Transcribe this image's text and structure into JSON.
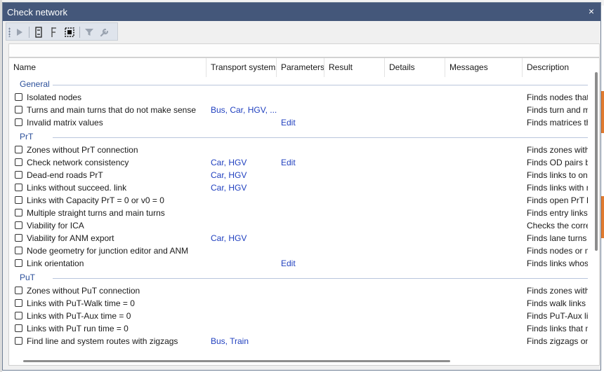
{
  "window": {
    "title": "Check network",
    "close_label": "×"
  },
  "toolbar": {
    "items": [
      {
        "name": "run-icon",
        "glyph": "▶"
      },
      {
        "name": "collapse-icon",
        "glyph": "⇟"
      },
      {
        "name": "expand-icon",
        "glyph": "⇞"
      },
      {
        "name": "select-icon",
        "glyph": "⬚"
      },
      {
        "name": "filter-icon",
        "glyph": "⏷"
      },
      {
        "name": "wrench-icon",
        "glyph": "✎"
      }
    ]
  },
  "columns": [
    "Name",
    "Transport systems",
    "Parameters",
    "Result",
    "Details",
    "Messages",
    "Description"
  ],
  "groups": [
    {
      "label": "General",
      "rows": [
        {
          "name": "Isolated nodes",
          "transport": "",
          "params": "",
          "desc": "Finds nodes that a"
        },
        {
          "name": "Turns and main turns that do not make sense",
          "transport": "Bus, Car, HGV, ...",
          "params": "",
          "desc": "Finds turn and mai"
        },
        {
          "name": "Invalid matrix values",
          "transport": "",
          "params": "Edit",
          "desc": "Finds matrices that"
        }
      ]
    },
    {
      "label": "PrT",
      "rows": [
        {
          "name": "Zones without PrT connection",
          "transport": "",
          "params": "",
          "desc": "Finds zones withou"
        },
        {
          "name": "Check network consistency",
          "transport": "Car, HGV",
          "params": "Edit",
          "desc": "Finds OD pairs bet"
        },
        {
          "name": "Dead-end roads PrT",
          "transport": "Car, HGV",
          "params": "",
          "desc": "Finds links to one-"
        },
        {
          "name": "Links without succeed. link",
          "transport": "Car, HGV",
          "params": "",
          "desc": "Finds links with no"
        },
        {
          "name": "Links with Capacity PrT = 0 or v0 = 0",
          "transport": "",
          "params": "",
          "desc": "Finds open PrT lin"
        },
        {
          "name": "Multiple straight turns and main turns",
          "transport": "",
          "params": "",
          "desc": "Finds entry links at"
        },
        {
          "name": "Viability for ICA",
          "transport": "",
          "params": "",
          "desc": "Checks the correc"
        },
        {
          "name": "Viability for ANM export",
          "transport": "Car, HGV",
          "params": "",
          "desc": "Finds lane turns wi"
        },
        {
          "name": "Node geometry for junction editor and ANM",
          "transport": "",
          "params": "",
          "desc": "Finds nodes or ma"
        },
        {
          "name": "Link orientation",
          "transport": "",
          "params": "Edit",
          "desc": "Finds links whose"
        }
      ]
    },
    {
      "label": "PuT",
      "rows": [
        {
          "name": "Zones without PuT connection",
          "transport": "",
          "params": "",
          "desc": "Finds zones withou"
        },
        {
          "name": "Links with PuT-Walk time = 0",
          "transport": "",
          "params": "",
          "desc": "Finds walk links wi"
        },
        {
          "name": "Links with PuT-Aux time = 0",
          "transport": "",
          "params": "",
          "desc": "Finds PuT-Aux link"
        },
        {
          "name": "Links with PuT run time = 0",
          "transport": "",
          "params": "",
          "desc": "Finds links that me"
        },
        {
          "name": "Find line and system routes with zigzags",
          "transport": "Bus, Train",
          "params": "",
          "desc": "Finds zigzags on li"
        }
      ]
    }
  ]
}
